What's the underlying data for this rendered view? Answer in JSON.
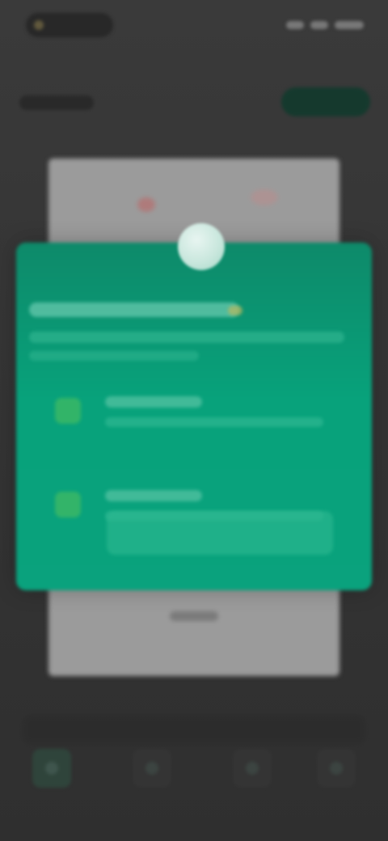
{
  "ui": {
    "status_bar": {
      "time": "",
      "icons": [
        "signal-icon",
        "wifi-icon",
        "battery-icon"
      ]
    },
    "header": {
      "left": "",
      "action": ""
    },
    "sheet": {
      "title": "",
      "subtitle": "",
      "options": [
        {
          "icon": "check-icon",
          "title": "",
          "description": ""
        },
        {
          "icon": "check-icon",
          "title": "",
          "description": ""
        }
      ],
      "cta": ""
    },
    "bottom_nav": {
      "items": [
        "home-icon",
        "search-icon",
        "profile-icon",
        "menu-icon"
      ]
    }
  },
  "colors": {
    "background": "#2f2f2f",
    "sheet_top": "#0e8a6a",
    "sheet_main": "#08a27b",
    "header_action": "#0f3a2c"
  }
}
